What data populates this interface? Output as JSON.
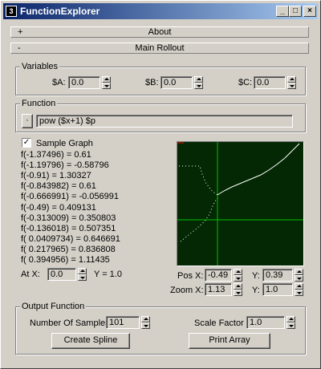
{
  "window": {
    "title": "FunctionExplorer",
    "min": "_",
    "max": "□",
    "close": "×"
  },
  "rollouts": {
    "about": {
      "sign": "+",
      "label": "About"
    },
    "main": {
      "sign": "-",
      "label": "Main Rollout"
    }
  },
  "variables": {
    "group_label": "Variables",
    "a_label": "$A:",
    "a_value": "0.0",
    "b_label": "$B:",
    "b_value": "0.0",
    "c_label": "$C:",
    "c_value": "0.0"
  },
  "function": {
    "group_label": "Function",
    "expression": "pow ($x+1) $p",
    "dropdown_glyph": "·"
  },
  "sample": {
    "label": "Sample Graph",
    "checked": "✓"
  },
  "samples": [
    "f(-1.37496) = 0.61",
    "f(-1.19796) = -0.58796",
    "f(-0.91) = 1.30327",
    "f(-0.843982) = 0.61",
    "f(-0.666991) = -0.056991",
    "f(-0.49) = 0.409131",
    "f(-0.313009) = 0.350803",
    "f(-0.136018) = 0.507351",
    "f( 0.0409734) = 0.646691",
    "f( 0.217965) = 0.836808",
    "f( 0.394956) = 1.11435"
  ],
  "atx": {
    "label": "At X:",
    "value": "0.0",
    "y_text": "Y = 1.0"
  },
  "view": {
    "posx_label": "Pos X:",
    "posx": "-0.49",
    "posy_label": "Y:",
    "posy": "0.39",
    "zoomx_label": "Zoom X:",
    "zoomx": "1.13",
    "zoomy_label": "Y:",
    "zoomy": "1.0"
  },
  "output": {
    "group_label": "Output Function",
    "samples_label": "Number Of Samples",
    "samples_value": "101",
    "scale_label": "Scale Factor",
    "scale_value": "1.0",
    "create_button": "Create Spline",
    "print_button": "Print Array"
  },
  "colors": {
    "graph_bg": "#032803",
    "axis": "#00c000",
    "curve": "#ffffff"
  }
}
